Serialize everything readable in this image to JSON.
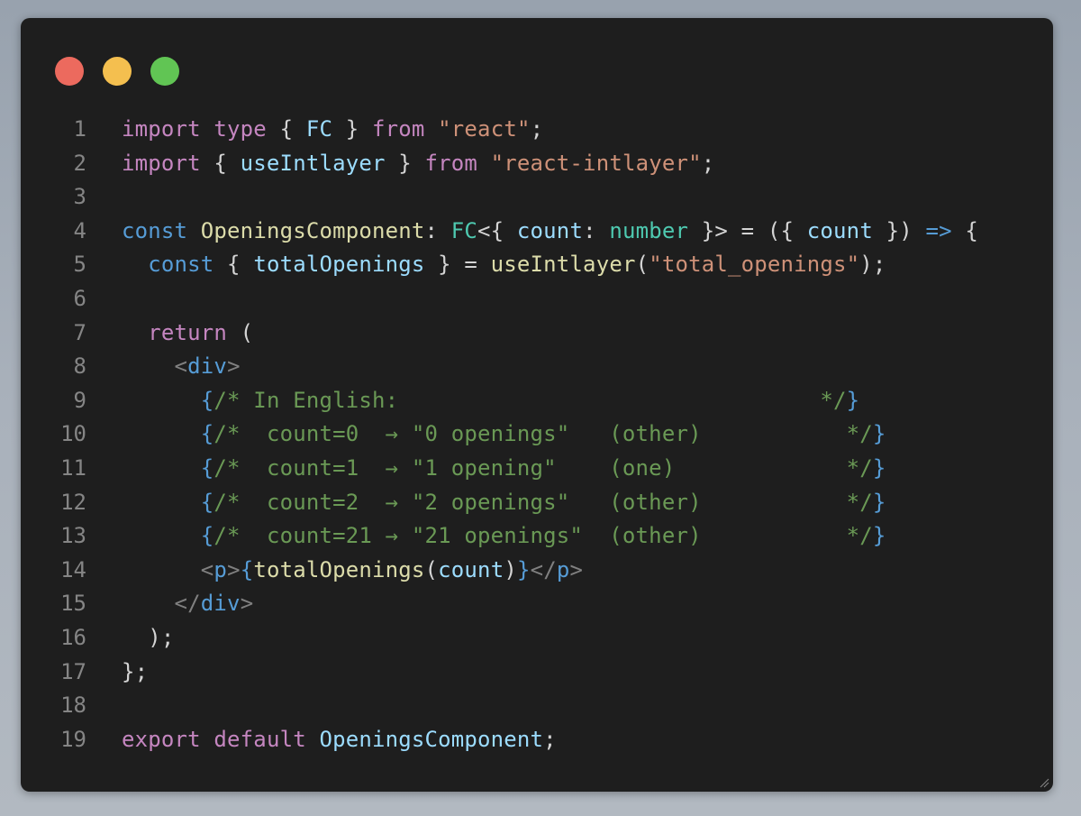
{
  "colors": {
    "background": "#1e1e1e",
    "close_dot": "#ec6a5e",
    "minimize_dot": "#f4bf4f",
    "maximize_dot": "#61c554",
    "line_number": "#858585",
    "default": "#d4d4d4",
    "keyword": "#c586c0",
    "storage": "#569cd6",
    "string": "#ce9178",
    "variable": "#9cdcfe",
    "function": "#dcdcaa",
    "type": "#4ec9b0",
    "comment": "#6a9955",
    "tag_bracket": "#808080",
    "bracket_yellow": "#ffd700"
  },
  "window_controls": [
    "close",
    "minimize",
    "maximize"
  ],
  "code": {
    "language": "tsx",
    "lines": [
      {
        "n": "1",
        "tokens": [
          [
            "import",
            "keyword"
          ],
          [
            " ",
            "default"
          ],
          [
            "type",
            "keyword"
          ],
          [
            " { ",
            "default"
          ],
          [
            "FC",
            "variable"
          ],
          [
            " } ",
            "default"
          ],
          [
            "from",
            "keyword"
          ],
          [
            " ",
            "default"
          ],
          [
            "\"react\"",
            "string"
          ],
          [
            ";",
            "default"
          ]
        ]
      },
      {
        "n": "2",
        "tokens": [
          [
            "import",
            "keyword"
          ],
          [
            " { ",
            "default"
          ],
          [
            "useIntlayer",
            "variable"
          ],
          [
            " } ",
            "default"
          ],
          [
            "from",
            "keyword"
          ],
          [
            " ",
            "default"
          ],
          [
            "\"react-intlayer\"",
            "string"
          ],
          [
            ";",
            "default"
          ]
        ]
      },
      {
        "n": "3",
        "tokens": []
      },
      {
        "n": "4",
        "tokens": [
          [
            "const",
            "storage"
          ],
          [
            " ",
            "default"
          ],
          [
            "OpeningsComponent",
            "function"
          ],
          [
            ": ",
            "default"
          ],
          [
            "FC",
            "type"
          ],
          [
            "<{ ",
            "default"
          ],
          [
            "count",
            "variable"
          ],
          [
            ": ",
            "default"
          ],
          [
            "number",
            "type"
          ],
          [
            " }> = ({ ",
            "default"
          ],
          [
            "count",
            "variable"
          ],
          [
            " }) ",
            "default"
          ],
          [
            "=>",
            "storage"
          ],
          [
            " {",
            "default"
          ]
        ]
      },
      {
        "n": "5",
        "tokens": [
          [
            "  ",
            "default"
          ],
          [
            "const",
            "storage"
          ],
          [
            " { ",
            "default"
          ],
          [
            "totalOpenings",
            "variable"
          ],
          [
            " } = ",
            "default"
          ],
          [
            "useIntlayer",
            "function"
          ],
          [
            "(",
            "default"
          ],
          [
            "\"total_openings\"",
            "string"
          ],
          [
            ");",
            "default"
          ]
        ]
      },
      {
        "n": "6",
        "tokens": []
      },
      {
        "n": "7",
        "tokens": [
          [
            "  ",
            "default"
          ],
          [
            "return",
            "keyword"
          ],
          [
            " (",
            "default"
          ]
        ]
      },
      {
        "n": "8",
        "tokens": [
          [
            "    ",
            "default"
          ],
          [
            "<",
            "tag_bracket"
          ],
          [
            "div",
            "storage"
          ],
          [
            ">",
            "tag_bracket"
          ]
        ]
      },
      {
        "n": "9",
        "tokens": [
          [
            "      ",
            "default"
          ],
          [
            "{",
            "storage"
          ],
          [
            "/* In English:                                */",
            "comment"
          ],
          [
            "}",
            "storage"
          ]
        ]
      },
      {
        "n": "10",
        "tokens": [
          [
            "      ",
            "default"
          ],
          [
            "{",
            "storage"
          ],
          [
            "/*  count=0  → \"0 openings\"   (other)           */",
            "comment"
          ],
          [
            "}",
            "storage"
          ]
        ]
      },
      {
        "n": "11",
        "tokens": [
          [
            "      ",
            "default"
          ],
          [
            "{",
            "storage"
          ],
          [
            "/*  count=1  → \"1 opening\"    (one)             */",
            "comment"
          ],
          [
            "}",
            "storage"
          ]
        ]
      },
      {
        "n": "12",
        "tokens": [
          [
            "      ",
            "default"
          ],
          [
            "{",
            "storage"
          ],
          [
            "/*  count=2  → \"2 openings\"   (other)           */",
            "comment"
          ],
          [
            "}",
            "storage"
          ]
        ]
      },
      {
        "n": "13",
        "tokens": [
          [
            "      ",
            "default"
          ],
          [
            "{",
            "storage"
          ],
          [
            "/*  count=21 → \"21 openings\"  (other)           */",
            "comment"
          ],
          [
            "}",
            "storage"
          ]
        ]
      },
      {
        "n": "14",
        "tokens": [
          [
            "      ",
            "default"
          ],
          [
            "<",
            "tag_bracket"
          ],
          [
            "p",
            "storage"
          ],
          [
            ">",
            "tag_bracket"
          ],
          [
            "{",
            "storage"
          ],
          [
            "totalOpenings",
            "function"
          ],
          [
            "(",
            "default"
          ],
          [
            "count",
            "variable"
          ],
          [
            ")",
            "default"
          ],
          [
            "}",
            "storage"
          ],
          [
            "</",
            "tag_bracket"
          ],
          [
            "p",
            "storage"
          ],
          [
            ">",
            "tag_bracket"
          ]
        ]
      },
      {
        "n": "15",
        "tokens": [
          [
            "    ",
            "default"
          ],
          [
            "</",
            "tag_bracket"
          ],
          [
            "div",
            "storage"
          ],
          [
            ">",
            "tag_bracket"
          ]
        ]
      },
      {
        "n": "16",
        "tokens": [
          [
            "  );",
            "default"
          ]
        ]
      },
      {
        "n": "17",
        "tokens": [
          [
            "};",
            "default"
          ]
        ]
      },
      {
        "n": "18",
        "tokens": []
      },
      {
        "n": "19",
        "tokens": [
          [
            "export",
            "keyword"
          ],
          [
            " ",
            "default"
          ],
          [
            "default",
            "keyword"
          ],
          [
            " ",
            "default"
          ],
          [
            "OpeningsComponent",
            "variable"
          ],
          [
            ";",
            "default"
          ]
        ]
      }
    ]
  }
}
